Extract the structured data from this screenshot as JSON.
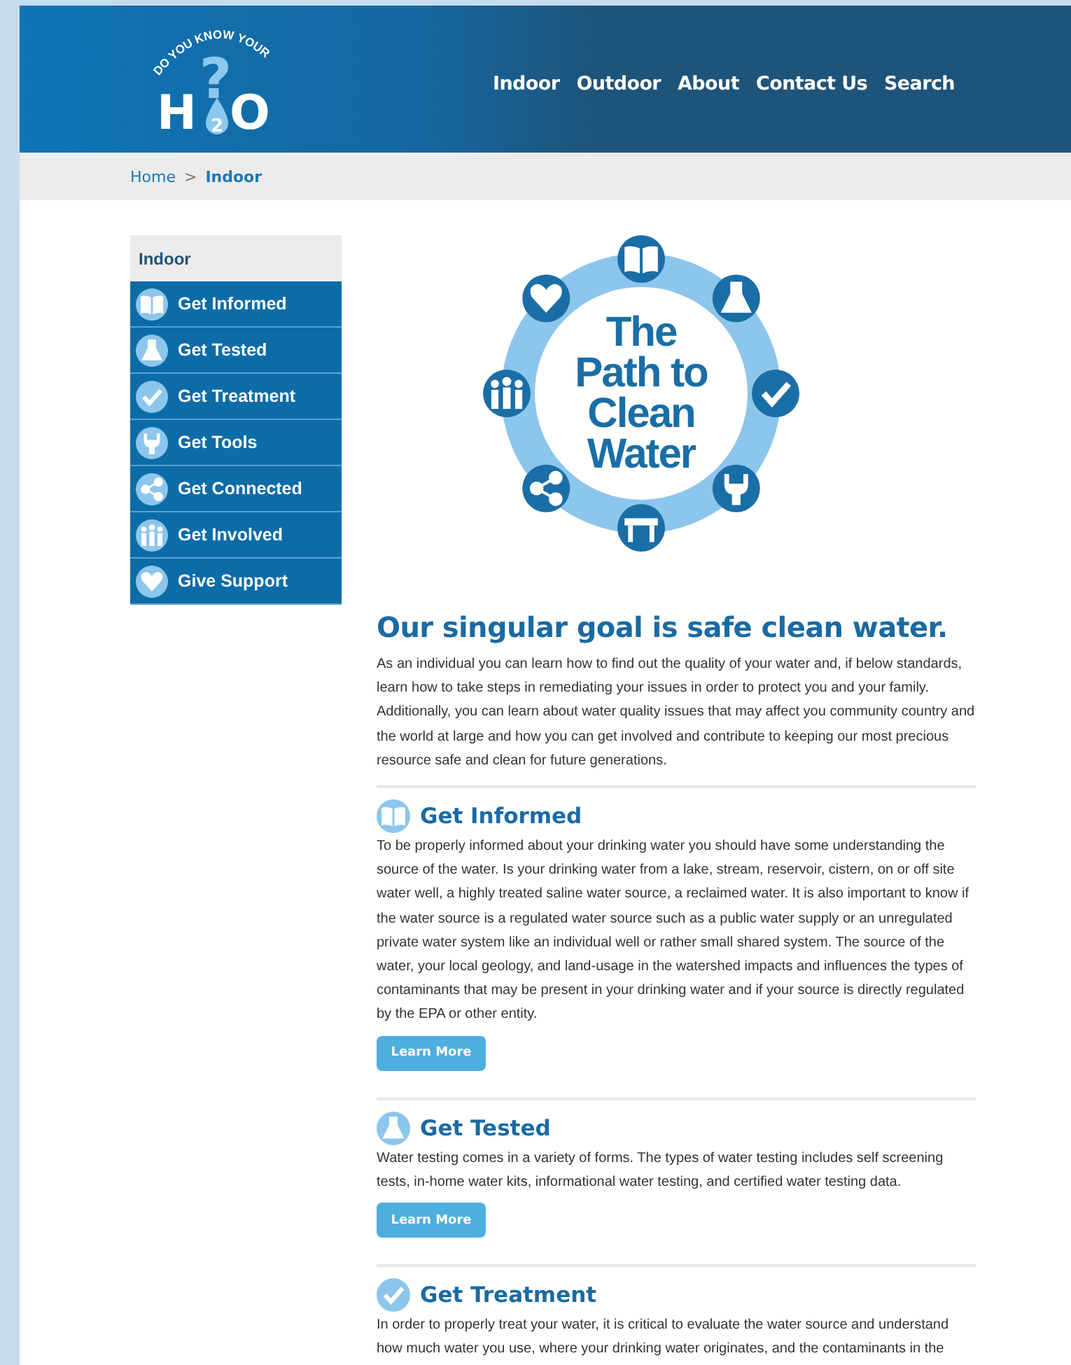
{
  "logo": {
    "tagline": "DO YOU KNOW YOUR",
    "symbol": "?",
    "letters": [
      "H",
      "2",
      "O"
    ]
  },
  "nav": [
    "Indoor",
    "Outdoor",
    "About",
    "Contact Us",
    "Search"
  ],
  "breadcrumb": {
    "links": [
      "Home"
    ],
    "separator": ">",
    "current": "Indoor"
  },
  "sidebar": {
    "title": "Indoor",
    "items": [
      {
        "label": "Get Informed",
        "kind": "book"
      },
      {
        "label": "Get Tested",
        "kind": "flask"
      },
      {
        "label": "Get Treatment",
        "kind": "check"
      },
      {
        "label": "Get Tools",
        "kind": "wrench"
      },
      {
        "label": "Get Connected",
        "kind": "share"
      },
      {
        "label": "Get Involved",
        "kind": "people"
      },
      {
        "label": "Give Support",
        "kind": "heart"
      }
    ]
  },
  "diagram": {
    "title_lines": [
      "The",
      "Path to",
      "Clean",
      "Water"
    ],
    "icons": [
      {
        "kind": "book"
      },
      {
        "kind": "flask"
      },
      {
        "kind": "check"
      },
      {
        "kind": "wrench"
      },
      {
        "kind": "table"
      },
      {
        "kind": "share"
      },
      {
        "kind": "people"
      },
      {
        "kind": "heart"
      }
    ]
  },
  "intro": {
    "heading": "Our singular goal is safe clean water.",
    "text": "As an individual you can learn how to find out the quality of your water and, if below standards, learn how to take steps in remediating your issues in order to protect you and your family. Additionally, you can learn about water quality issues that may affect you community country and the world at large and how you can get involved and contribute to keeping our most precious resource safe and clean for future generations."
  },
  "sections": [
    {
      "kind": "book",
      "title": "Get Informed",
      "text": "To be properly informed about your drinking water you should have some understanding the source of the water. Is your drinking water from a lake, stream, reservoir, cistern, on or off site water well, a highly treated saline water source, a reclaimed water. It is also important to know if the water source is a regulated water source such as a public water supply or an unregulated private water system like an individual well or rather small shared system. The source of the water, your local geology, and land-usage in the watershed impacts and influences the types of contaminants that may be present in your drinking water and if your source is directly regulated by the EPA or other entity.",
      "button": "Learn More"
    },
    {
      "kind": "flask",
      "title": "Get Tested",
      "text": "Water testing comes in a variety of forms. The types of water testing includes self screening tests, in-home water kits, informational water testing, and certified water testing data.",
      "button": "Learn More"
    },
    {
      "kind": "check",
      "title": "Get Treatment",
      "text": "In order to properly treat your water, it is critical to evaluate the water source and understand how much water you use, where your drinking water originates, and the contaminants in the"
    }
  ]
}
